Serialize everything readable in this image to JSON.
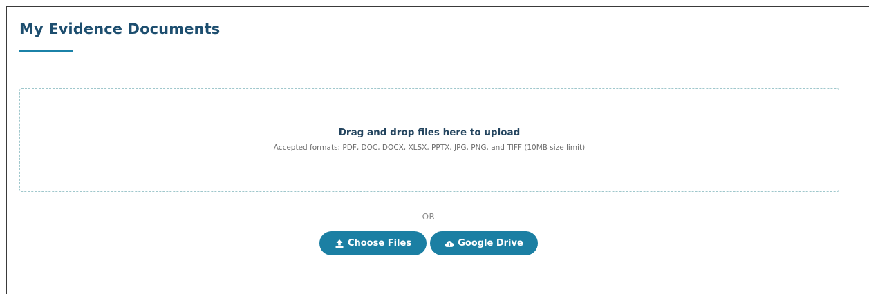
{
  "page": {
    "title": "My Evidence Documents"
  },
  "dropzone": {
    "title": "Drag and drop files here to upload",
    "formats": "Accepted formats: PDF, DOC, DOCX, XLSX, PPTX, JPG, PNG, and TIFF (10MB size limit)"
  },
  "divider": {
    "or_text": "- OR -"
  },
  "buttons": {
    "choose_files": {
      "label": "Choose Files",
      "icon": "upload-icon"
    },
    "google_drive": {
      "label": "Google Drive",
      "icon": "cloud-upload-icon"
    }
  },
  "colors": {
    "title": "#1d4e6f",
    "accent": "#1b82a8",
    "button": "#1b7fa3",
    "dropzone_border": "#9fc7cc"
  }
}
